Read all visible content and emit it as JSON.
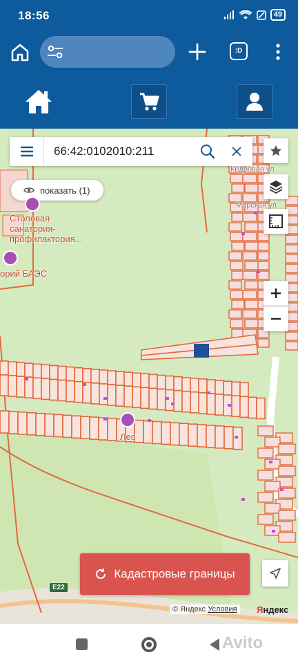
{
  "status": {
    "time": "18:56",
    "battery": "49"
  },
  "browser": {
    "tab_label": ":D"
  },
  "search": {
    "value": "66:42:0102010:211"
  },
  "map": {
    "show_button_label": "показать (1)",
    "labels": {
      "sanatorium": "Столовая санатория-профилактория...",
      "baes": "орий БАЭС",
      "forest": "Лес",
      "kedrovaya": "Кедровая ул",
      "morskaya": "Морская ул"
    },
    "road_badge": "E22",
    "copyright": "© Яндекс",
    "terms": "Условия",
    "logo_y": "Я",
    "logo_rest": "ндекс"
  },
  "cadastre_button": {
    "label": "Кадастровые границы"
  },
  "watermark": "Avito",
  "colors": {
    "header": "#0d5a9c",
    "map_bg": "#d6eabf",
    "parcel_border": "#e06a3c",
    "selected_parcel": "#1f4f9a",
    "cadastre_button": "#d9534f"
  }
}
